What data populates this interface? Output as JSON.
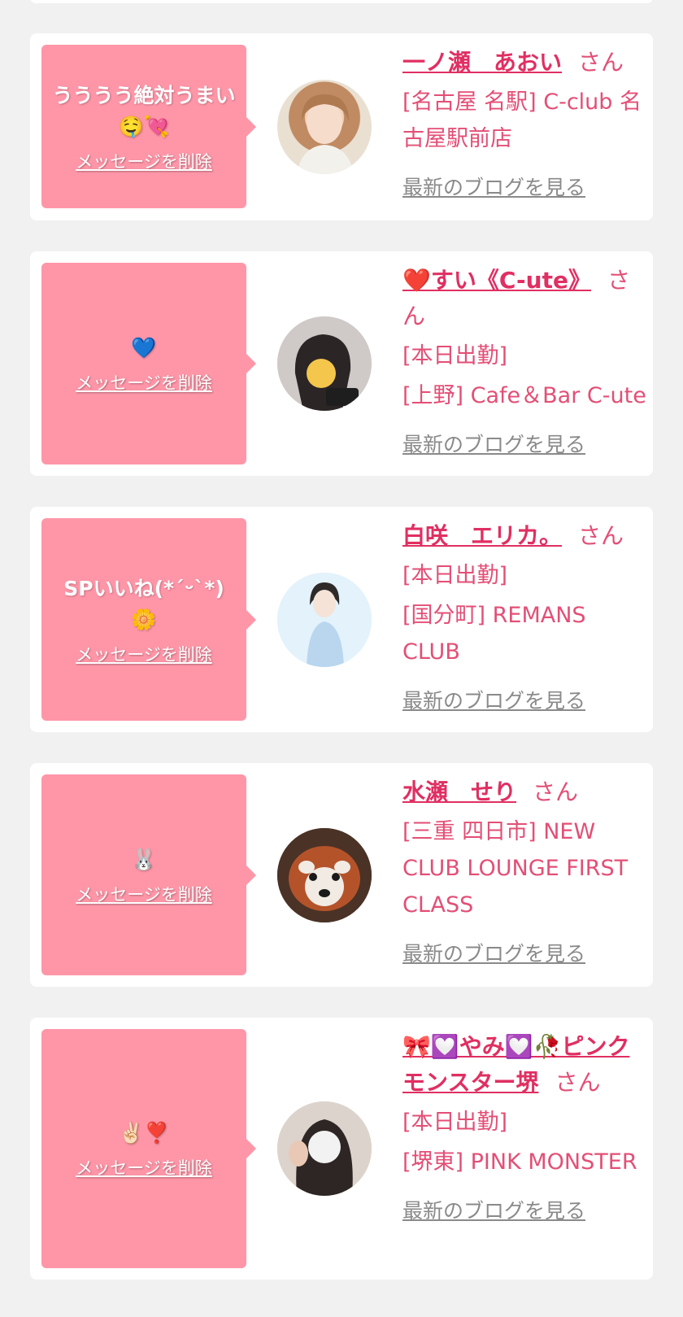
{
  "cards": [
    {
      "message": "うううう絶対うまい🤤💘",
      "delete_label": "メッセージを削除",
      "name": "一ノ瀬　あおい",
      "honorific": "さん",
      "lines": [
        "[名古屋 名駅] C-club 名古屋駅前店"
      ],
      "blog_label": "最新のブログを見る"
    },
    {
      "message": "💙",
      "delete_label": "メッセージを削除",
      "name": "❤️すい《C-ute》",
      "honorific": "さん",
      "lines": [
        "[本日出勤]",
        "[上野] Cafe＆Bar C-ute"
      ],
      "blog_label": "最新のブログを見る"
    },
    {
      "message": "SPいいね(*´ᵕ`*)🌼",
      "delete_label": "メッセージを削除",
      "name": "白咲　エリカ。",
      "honorific": "さん",
      "lines": [
        "[本日出勤]",
        "[国分町] REMANS CLUB"
      ],
      "blog_label": "最新のブログを見る"
    },
    {
      "message": "🐰",
      "delete_label": "メッセージを削除",
      "name": "水瀬　せり",
      "honorific": "さん",
      "lines": [
        "[三重 四日市] NEW CLUB LOUNGE FIRST CLASS"
      ],
      "blog_label": "最新のブログを見る"
    },
    {
      "message": "✌🏻❣️",
      "delete_label": "メッセージを削除",
      "name": "🎀💟やみ💟🥀ピンクモンスター堺",
      "honorific": "さん",
      "lines": [
        "[本日出勤]",
        "[堺東] PINK MONSTER"
      ],
      "blog_label": "最新のブログを見る"
    }
  ],
  "colors": {
    "bubble": "#ff96a8",
    "name": "#e02f62",
    "text": "#e34f76",
    "link_gray": "#8a8a8a",
    "background": "#f1f1f1"
  }
}
